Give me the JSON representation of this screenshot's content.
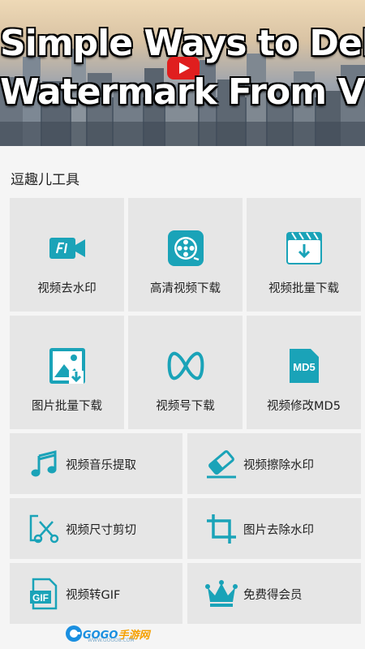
{
  "banner": {
    "line1": "Simple Ways to Delete",
    "line2": "Watermark From Video",
    "play_icon": "youtube-play-icon"
  },
  "section": {
    "title": "逗趣儿工具"
  },
  "tools": {
    "video_remove_watermark": "视频去水印",
    "hd_video_download": "高清视频下载",
    "batch_video_download": "视频批量下载",
    "batch_image_download": "图片批量下载",
    "channel_download": "视频号下载",
    "modify_md5": "视频修改MD5",
    "md5_badge": "MD5",
    "extract_music": "视频音乐提取",
    "erase_watermark": "视频擦除水印",
    "crop_video": "视频尺寸剪切",
    "image_remove_watermark": "图片去除水印",
    "video_to_gif": "视频转GIF",
    "gif_badge": "GIF",
    "free_vip": "免费得会员"
  },
  "colors": {
    "accent": "#1aa3b8",
    "tile_bg": "#e6e6e6",
    "page_bg": "#f5f5f5"
  },
  "footer": {
    "brand_a": "GOGO",
    "brand_b": "手游网",
    "url": "WWW.GOGO8.COM"
  }
}
